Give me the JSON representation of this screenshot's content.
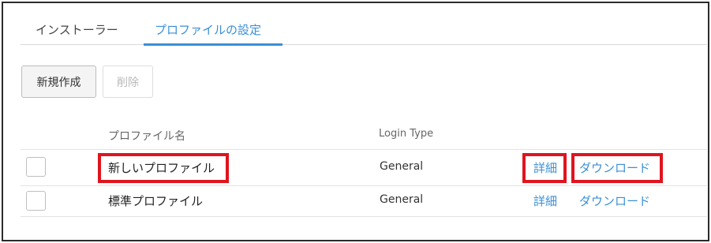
{
  "tabs": [
    {
      "label": "インストーラー",
      "active": false
    },
    {
      "label": "プロファイルの設定",
      "active": true
    }
  ],
  "toolbar": {
    "new_label": "新規作成",
    "delete_label": "削除",
    "delete_enabled": false
  },
  "table": {
    "columns": [
      "プロファイル名",
      "Login Type"
    ],
    "rows": [
      {
        "checked": false,
        "name": "新しいプロファイル",
        "login_type": "General",
        "detail_label": "詳細",
        "download_label": "ダウンロード",
        "highlighted": true
      },
      {
        "checked": false,
        "name": "標準プロファイル",
        "login_type": "General",
        "detail_label": "詳細",
        "download_label": "ダウンロード",
        "highlighted": false
      }
    ]
  },
  "colors": {
    "accent": "#3a8fd6",
    "highlight": "#e0141e",
    "frame_border": "#2b2b2b"
  }
}
